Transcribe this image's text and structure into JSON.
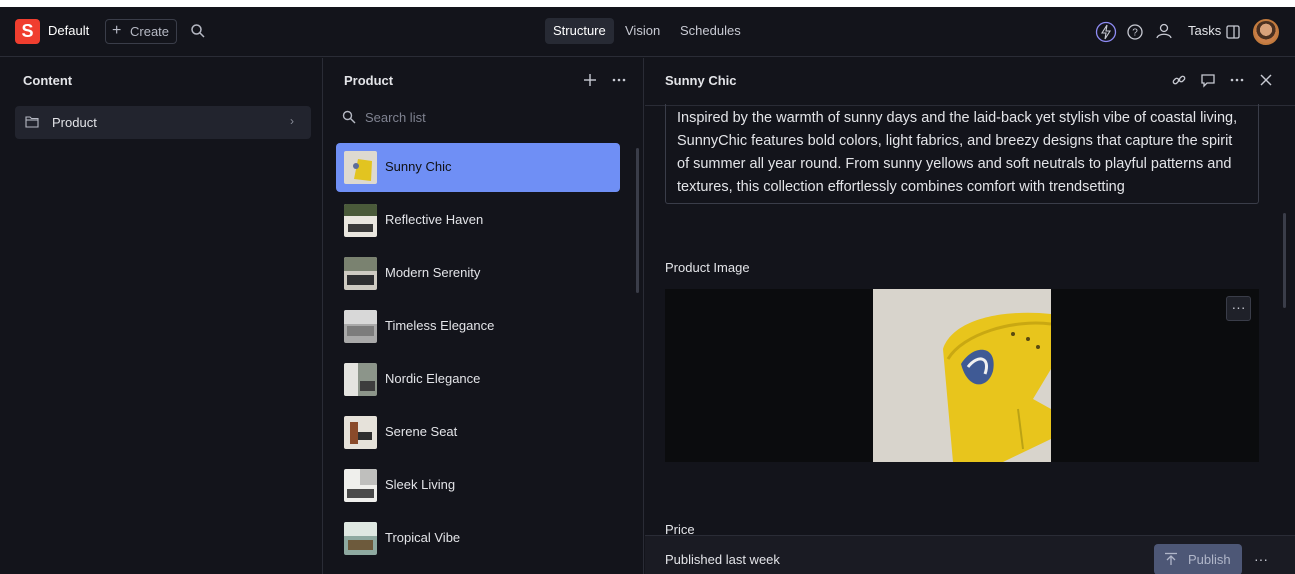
{
  "header": {
    "logo_letter": "S",
    "workspace": "Default",
    "create_label": "Create",
    "tabs": [
      "Structure",
      "Vision",
      "Schedules"
    ],
    "active_tab": "Structure",
    "tasks_label": "Tasks"
  },
  "content_pane": {
    "title": "Content",
    "items": [
      {
        "label": "Product",
        "icon": "folder-icon"
      }
    ]
  },
  "product_pane": {
    "title": "Product",
    "search_placeholder": "Search list",
    "items": [
      {
        "label": "Sunny Chic",
        "selected": true
      },
      {
        "label": "Reflective Haven"
      },
      {
        "label": "Modern Serenity"
      },
      {
        "label": "Timeless Elegance"
      },
      {
        "label": "Nordic Elegance"
      },
      {
        "label": "Serene Seat"
      },
      {
        "label": "Sleek Living"
      },
      {
        "label": "Tropical Vibe"
      }
    ]
  },
  "document": {
    "title": "Sunny Chic",
    "description": "Inspired by the warmth of sunny days and the laid-back yet stylish vibe of coastal living, SunnyChic features bold colors, light fabrics, and breezy designs that capture the spirit of summer all year round. From sunny yellows and soft neutrals to playful patterns and textures, this collection effortlessly combines comfort with trendsetting",
    "image_label": "Product Image",
    "image_more": "···",
    "price_label": "Price",
    "status": "Published last week",
    "publish_label": "Publish",
    "footer_more": "···"
  },
  "colors": {
    "accent": "#6f8ff5",
    "brand": "#f03e2f",
    "background": "#13141b",
    "publish_button": "#4d5776"
  }
}
